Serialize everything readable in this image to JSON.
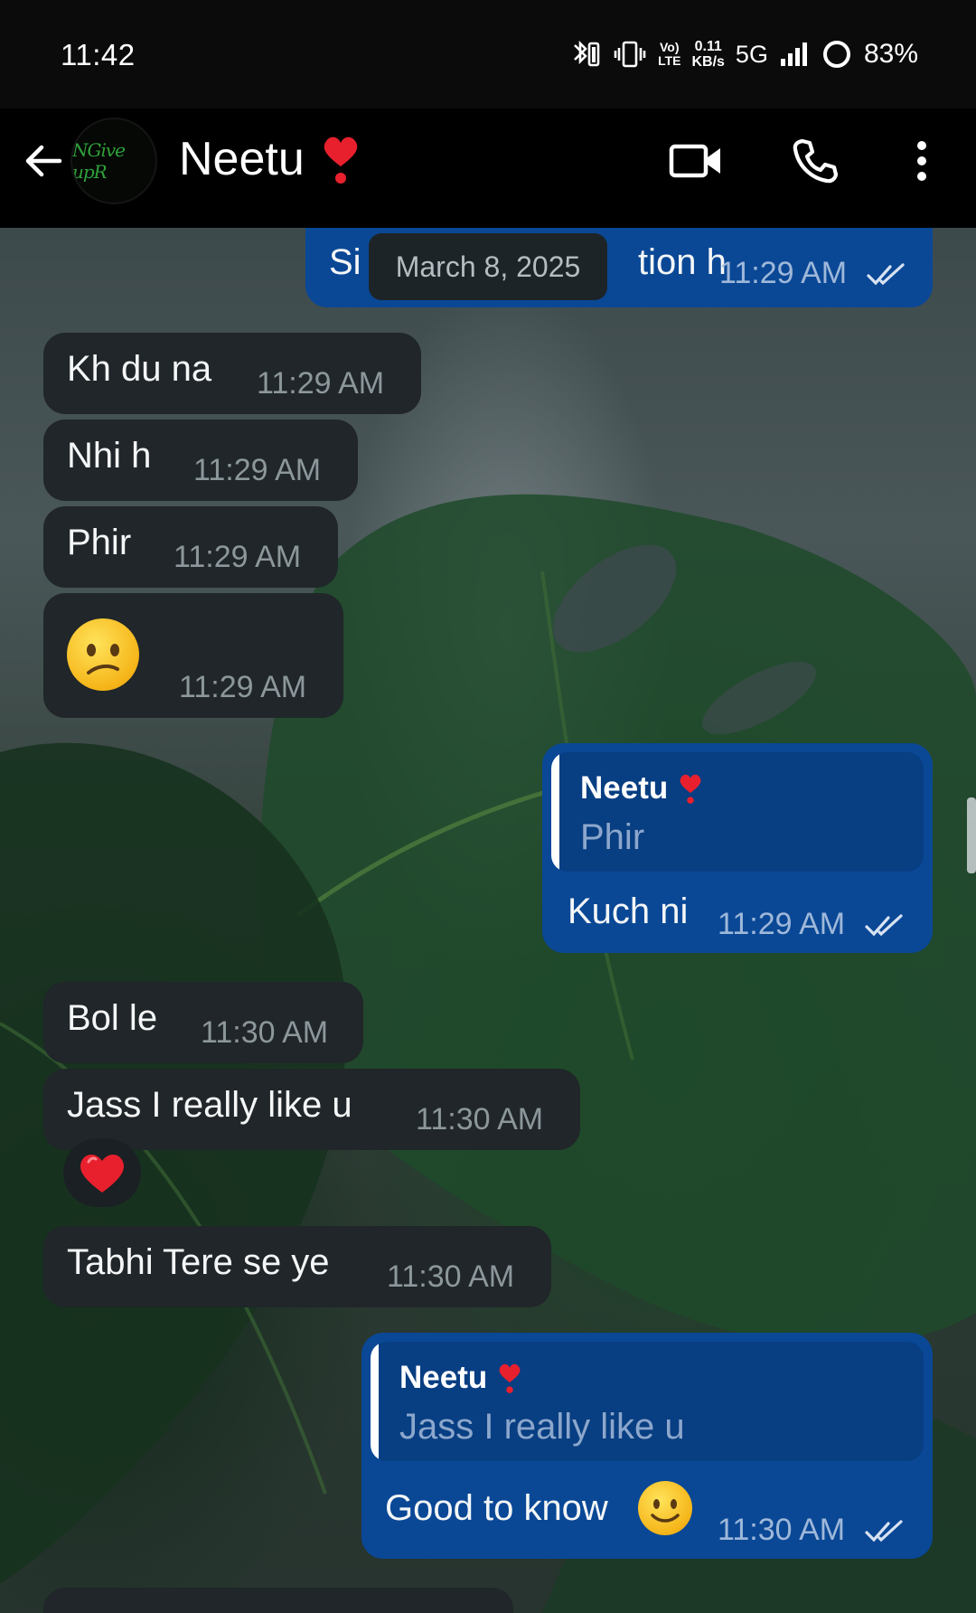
{
  "status_bar": {
    "time": "11:42",
    "volte": "Vo)\nLTE",
    "net_speed": "0.11\nKB/s",
    "network": "5G",
    "battery": "83%"
  },
  "header": {
    "contact_name": "Neetu",
    "avatar_text": "NGive upR",
    "icons": [
      "back-arrow-icon",
      "video-call-icon",
      "phone-icon",
      "more-vert-icon"
    ]
  },
  "chat": {
    "date_pill": "March 8, 2025",
    "top_partial": {
      "text_left": "Si",
      "text_right": "tion h",
      "time": "11:29 AM"
    },
    "messages": [
      {
        "dir": "in",
        "text": "Kh du na",
        "time": "11:29 AM"
      },
      {
        "dir": "in",
        "text": "Nhi h",
        "time": "11:29 AM"
      },
      {
        "dir": "in",
        "text": "Phir",
        "time": "11:29 AM"
      },
      {
        "dir": "in",
        "emoji": "confused-face",
        "time": "11:29 AM"
      },
      {
        "dir": "out",
        "reply_to": {
          "name": "Neetu",
          "text": "Phir"
        },
        "text": "Kuch ni",
        "time": "11:29 AM"
      },
      {
        "dir": "in",
        "text": "Bol le",
        "time": "11:30 AM"
      },
      {
        "dir": "in",
        "text": "Jass I really like u",
        "time": "11:30 AM",
        "reaction": "heart"
      },
      {
        "dir": "in",
        "text": "Tabhi Tere se ye",
        "time": "11:30 AM"
      },
      {
        "dir": "out",
        "reply_to": {
          "name": "Neetu",
          "text": "Jass I really like u"
        },
        "text": "Good to know",
        "time": "11:30 AM"
      }
    ],
    "bottom_partial": {
      "text": ""
    }
  },
  "colors": {
    "incoming_bubble": "#202629",
    "outgoing_bubble": "#0a4896",
    "reply_box": "#083e82",
    "heart": "#e8202e"
  }
}
